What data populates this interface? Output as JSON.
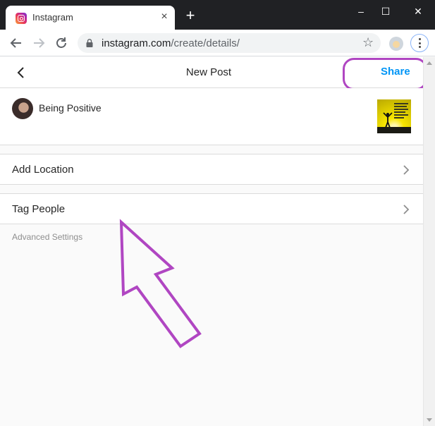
{
  "browser": {
    "tab_title": "Instagram",
    "tab_close": "×",
    "new_tab": "+",
    "window_controls": {
      "minimize": "–",
      "maximize": "☐",
      "close": "✕"
    },
    "url_host": "instagram.com",
    "url_path": "/create/details/",
    "bookmark_star": "☆"
  },
  "header": {
    "title": "New Post",
    "share_label": "Share",
    "back_icon": "chevron-left-icon"
  },
  "post": {
    "caption": "Being Positive"
  },
  "options": {
    "add_location": "Add Location",
    "tag_people": "Tag People",
    "advanced_settings": "Advanced Settings"
  },
  "colors": {
    "accent": "#0095f6",
    "annotation": "#b046c2",
    "border": "#dbdbdb"
  }
}
